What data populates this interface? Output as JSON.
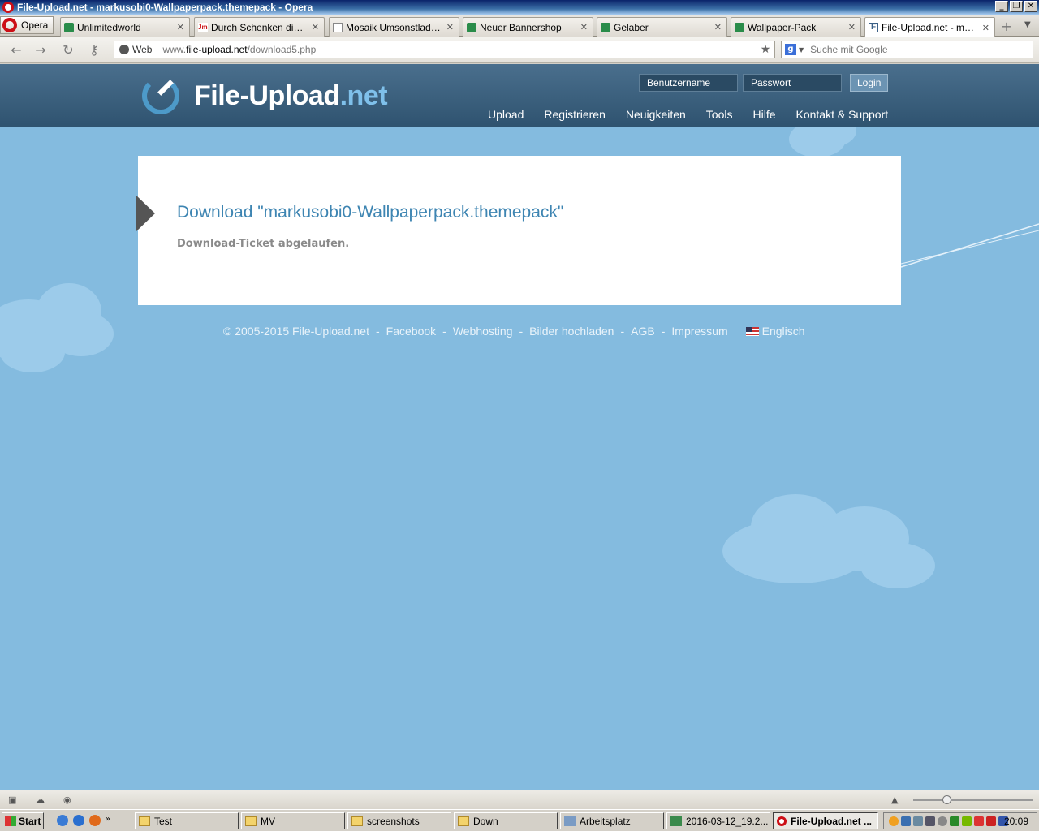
{
  "window": {
    "title": "File-Upload.net - markusobi0-Wallpaperpack.themepack - Opera"
  },
  "browser": {
    "menu_label": "Opera",
    "tabs": [
      {
        "label": "Unlimitedworld",
        "active": false
      },
      {
        "label": "Durch Schenken die Ba...",
        "active": false
      },
      {
        "label": "Mosaik Umsonstladen u...",
        "active": false
      },
      {
        "label": "Neuer Bannershop",
        "active": false
      },
      {
        "label": "Gelaber",
        "active": false
      },
      {
        "label": "Wallpaper-Pack",
        "active": false
      },
      {
        "label": "File-Upload.net - mark...",
        "active": true
      }
    ],
    "address": {
      "badge": "Web",
      "url_prefix": "www.",
      "url_domain": "file-upload.net",
      "url_path": "/download5.php"
    },
    "search": {
      "placeholder": "Suche mit Google"
    }
  },
  "site": {
    "logo_main": "File-Upload",
    "logo_tld": ".net",
    "login": {
      "username_placeholder": "Benutzername",
      "password_placeholder": "Passwort",
      "button": "Login"
    },
    "nav": [
      "Upload",
      "Registrieren",
      "Neuigkeiten",
      "Tools",
      "Hilfe",
      "Kontakt & Support"
    ],
    "panel": {
      "title": "Download \"markusobi0-Wallpaperpack.themepack\"",
      "message": "Download-Ticket abgelaufen."
    },
    "footer": {
      "copyright": "© 2005-2015 File-Upload.net",
      "links": [
        "Facebook",
        "Webhosting",
        "Bilder hochladen",
        "AGB",
        "Impressum"
      ],
      "separator": "-",
      "language": "Englisch"
    },
    "colors": {
      "background": "#84bbdf",
      "header": "#3b5f7d",
      "title": "#3e85b2"
    }
  },
  "taskbar": {
    "start": "Start",
    "buttons": [
      {
        "label": "Test",
        "icon": "folder-icon"
      },
      {
        "label": "MV",
        "icon": "folder-icon"
      },
      {
        "label": "screenshots",
        "icon": "folder-icon"
      },
      {
        "label": "Down",
        "icon": "folder-icon"
      },
      {
        "label": "Arbeitsplatz",
        "icon": "computer-icon"
      },
      {
        "label": "2016-03-12_19.2...",
        "icon": "image-icon"
      },
      {
        "label": "File-Upload.net ...",
        "icon": "opera-icon"
      }
    ],
    "clock": "20:09"
  }
}
